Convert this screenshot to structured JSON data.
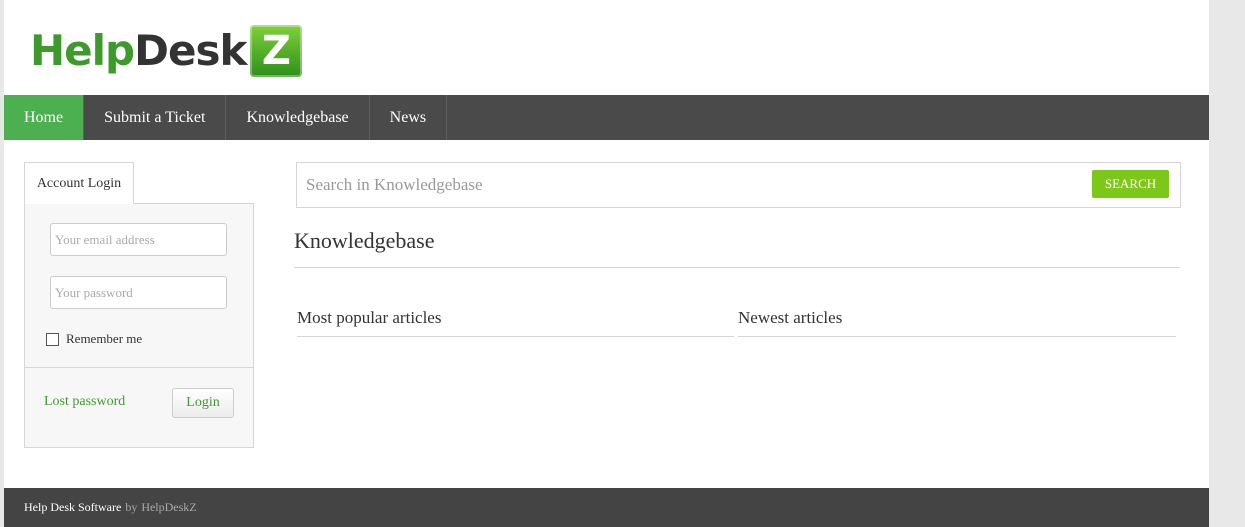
{
  "logo": {
    "part1": "Help",
    "part2": "Desk",
    "badge": "Z"
  },
  "nav": [
    {
      "label": "Home"
    },
    {
      "label": "Submit a Ticket"
    },
    {
      "label": "Knowledgebase"
    },
    {
      "label": "News"
    }
  ],
  "login": {
    "tab": "Account Login",
    "email_placeholder": "Your email address",
    "password_placeholder": "Your password",
    "remember": "Remember me",
    "lost_password": "Lost password",
    "button": "Login"
  },
  "search": {
    "placeholder": "Search in Knowledgebase",
    "button": "SEARCH"
  },
  "main": {
    "title": "Knowledgebase",
    "popular": "Most popular articles",
    "newest": "Newest articles"
  },
  "footer": {
    "text": "Help Desk Software",
    "by": "by",
    "brand": "HelpDeskZ"
  },
  "colors": {
    "accent": "#4caf50",
    "search_button": "#7cc718",
    "nav_bg": "#4a4a4a"
  }
}
